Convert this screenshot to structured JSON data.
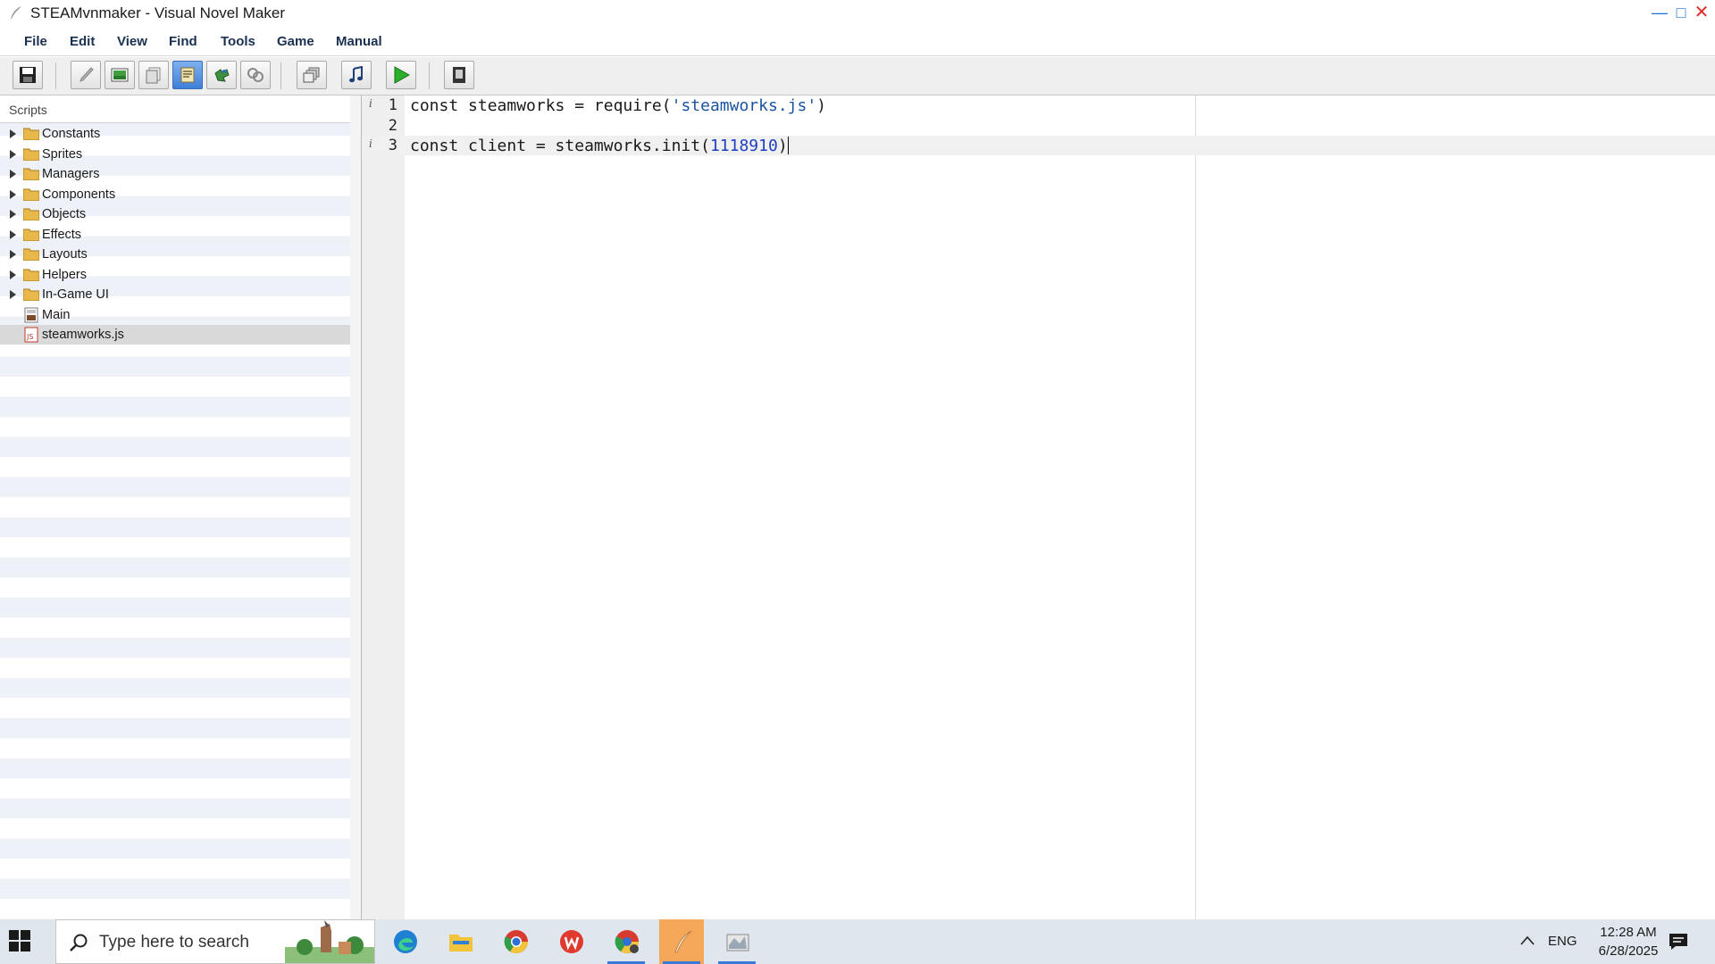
{
  "window": {
    "title": "STEAMvnmaker - Visual Novel Maker"
  },
  "menu": [
    "File",
    "Edit",
    "View",
    "Find",
    "Tools",
    "Game",
    "Manual"
  ],
  "toolbar": {
    "buttons": [
      "save-icon",
      "pencil-icon",
      "image-icon",
      "pages-icon",
      "script-icon",
      "puzzle-icon",
      "link-icon",
      "layers-icon",
      "music-icon",
      "play-icon",
      "book-icon"
    ]
  },
  "sidebar": {
    "title": "Scripts",
    "folders": [
      "Constants",
      "Sprites",
      "Managers",
      "Components",
      "Objects",
      "Effects",
      "Layouts",
      "Helpers",
      "In-Game UI"
    ],
    "files": [
      {
        "label": "Main",
        "icon": "script-file-icon"
      },
      {
        "label": "steamworks.js",
        "icon": "js-file-icon"
      }
    ],
    "selected": "steamworks.js"
  },
  "editor": {
    "lines": [
      {
        "num": "1",
        "mark": "i",
        "kw": "const",
        "rest": " steamworks = require(",
        "str": "'steamworks.js'",
        "end": ")"
      },
      {
        "num": "2",
        "mark": "",
        "kw": "",
        "rest": "",
        "str": "",
        "end": ""
      },
      {
        "num": "3",
        "mark": "i",
        "kw": "const",
        "rest": " client = steamworks.init(",
        "num_literal": "1118910",
        "end": ")"
      }
    ],
    "current_line": 3
  },
  "taskbar": {
    "search_placeholder": "Type here to search",
    "apps": [
      "edge-icon",
      "file-explorer-icon",
      "chrome-icon",
      "wps-office-icon",
      "chrome-profile-icon",
      "vnmaker-icon",
      "game-window-icon"
    ],
    "language": "ENG",
    "time": "12:28 AM",
    "date": "6/28/2025"
  },
  "colors": {
    "accent": "#3b7ad8",
    "active_app": "#f5a85a",
    "close": "#e02a2a"
  }
}
